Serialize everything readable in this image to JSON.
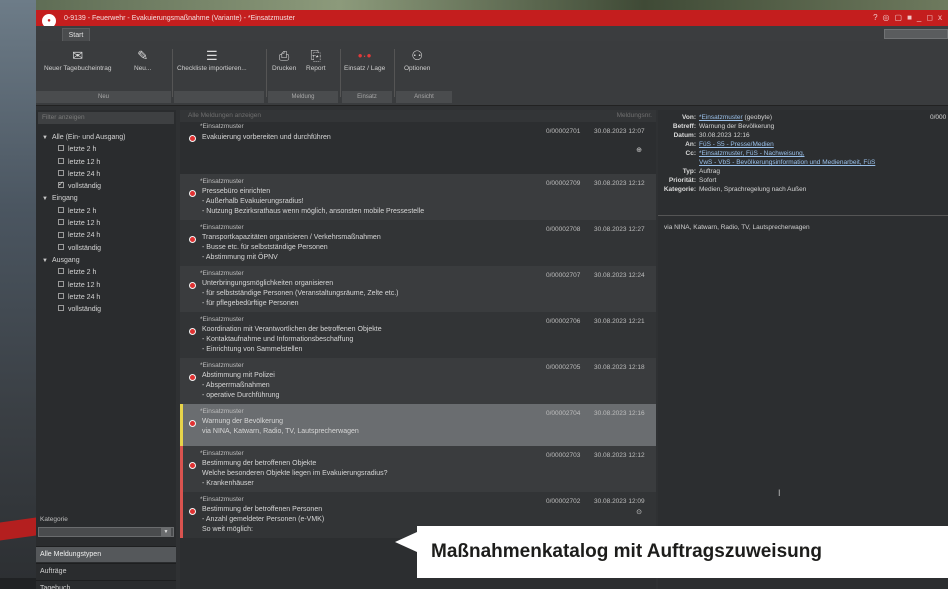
{
  "window": {
    "title": "0-9139 - Feuerwehr - Evakuierungsmaßnahme (Variante) - *Einsatzmuster",
    "controls": [
      "?",
      "◎",
      "▢",
      "■",
      "_",
      "◻",
      "x"
    ]
  },
  "tabs": [
    {
      "label": "Start"
    }
  ],
  "ribbon": {
    "buttons": [
      {
        "label": "Neuer Tagebucheintrag",
        "icon": "✉"
      },
      {
        "label": "Neu...",
        "icon": "✎"
      },
      {
        "label": "Checkliste importieren...",
        "icon": "☰"
      },
      {
        "label": "Drucken",
        "icon": "⎙"
      },
      {
        "label": "Report",
        "icon": "⎘"
      },
      {
        "label": "Einsatz / Lage",
        "icon": "•·•"
      },
      {
        "label": "Optionen",
        "icon": "⚇"
      }
    ],
    "groups": [
      {
        "label": "Neu"
      },
      {
        "label": "Meldung"
      },
      {
        "label": "Einsatz"
      },
      {
        "label": "Ansicht"
      }
    ]
  },
  "left_panel": {
    "filter_placeholder": "Filter anzeigen",
    "tree": [
      {
        "type": "group",
        "label": "Alle (Ein- und Ausgang)"
      },
      {
        "type": "child",
        "label": "letzte 2 h",
        "checked": false
      },
      {
        "type": "child",
        "label": "letzte 12 h",
        "checked": false
      },
      {
        "type": "child",
        "label": "letzte 24 h",
        "checked": false
      },
      {
        "type": "child",
        "label": "vollständig",
        "checked": true
      },
      {
        "type": "group",
        "label": "Eingang"
      },
      {
        "type": "child",
        "label": "letzte 2 h",
        "checked": false
      },
      {
        "type": "child",
        "label": "letzte 12 h",
        "checked": false
      },
      {
        "type": "child",
        "label": "letzte 24 h",
        "checked": false
      },
      {
        "type": "child",
        "label": "vollständig",
        "checked": false
      },
      {
        "type": "group",
        "label": "Ausgang"
      },
      {
        "type": "child",
        "label": "letzte 2 h",
        "checked": false
      },
      {
        "type": "child",
        "label": "letzte 12 h",
        "checked": false
      },
      {
        "type": "child",
        "label": "letzte 24 h",
        "checked": false
      },
      {
        "type": "child",
        "label": "vollständig",
        "checked": false
      }
    ],
    "category_label": "Kategorie",
    "category_value": "",
    "nav": [
      {
        "label": "Alle Meldungstypen",
        "active": true
      },
      {
        "label": "Aufträge",
        "active": false
      },
      {
        "label": "Tagebuch",
        "active": false
      }
    ]
  },
  "messages": {
    "header_text": "Alle Meldungen anzeigen",
    "header_right": "Meldungsnr.",
    "items": [
      {
        "author": "*Einsatzmuster",
        "num": "0/00002701",
        "date": "30.08.2023 12:07",
        "lines": [
          "Evakuierung vorbereiten und durchführen"
        ],
        "bar": "",
        "icon": "⊕",
        "bg": "#2c2e30"
      },
      {
        "author": "*Einsatzmuster",
        "num": "0/00002709",
        "date": "30.08.2023 12:12",
        "lines": [
          "Pressebüro einrichten",
          "- Außerhalb Evakuierungsradius!",
          "- Nutzung Bezirksrathaus wenn möglich, ansonsten mobile Pressestelle"
        ],
        "bar": "",
        "icon": "",
        "bg": "#3a3c3e"
      },
      {
        "author": "*Einsatzmuster",
        "num": "0/00002708",
        "date": "30.08.2023 12:27",
        "lines": [
          "Transportkapazitäten organisieren / Verkehrsmaßnahmen",
          "- Busse etc. für selbstständige Personen",
          "- Abstimmung mit ÖPNV"
        ],
        "bar": "",
        "icon": "",
        "bg": "#323436"
      },
      {
        "author": "*Einsatzmuster",
        "num": "0/00002707",
        "date": "30.08.2023 12:24",
        "lines": [
          "Unterbringungsmöglichkeiten organisieren",
          "- für selbstständige Personen (Veranstaltungsräume, Zelte etc.)",
          "- für pflegebedürftige Personen"
        ],
        "bar": "",
        "icon": "",
        "bg": "#3a3c3e"
      },
      {
        "author": "*Einsatzmuster",
        "num": "0/00002706",
        "date": "30.08.2023 12:21",
        "lines": [
          "Koordination mit Verantwortlichen der betroffenen Objekte",
          "- Kontaktaufnahme und Informationsbeschaffung",
          "- Einrichtung von Sammelstellen"
        ],
        "bar": "",
        "icon": "",
        "bg": "#323436"
      },
      {
        "author": "*Einsatzmuster",
        "num": "0/00002705",
        "date": "30.08.2023 12:18",
        "lines": [
          "Abstimmung mit Polizei",
          "- Absperrmaßnahmen",
          "- operative Durchführung"
        ],
        "bar": "",
        "icon": "",
        "bg": "#3a3c3e"
      },
      {
        "author": "*Einsatzmuster",
        "num": "0/00002704",
        "date": "30.08.2023 12:16",
        "lines": [
          "Warnung der Bevölkerung",
          "via NINA, Katwarn, Radio, TV, Lautsprecherwagen"
        ],
        "bar": "#e8d44a",
        "icon": "",
        "bg": "#6a6d70"
      },
      {
        "author": "*Einsatzmuster",
        "num": "0/00002703",
        "date": "30.08.2023 12:12",
        "lines": [
          "Bestimmung der betroffenen Objekte",
          "Welche besonderen Objekte liegen im Evakuierungsradius?",
          "- Krankenhäuser"
        ],
        "bar": "#d9534f",
        "icon": "",
        "bg": "#3a3c3e"
      },
      {
        "author": "*Einsatzmuster",
        "num": "0/00002702",
        "date": "30.08.2023 12:09",
        "lines": [
          "Bestimmung der betroffenen Personen",
          "- Anzahl gemeldeter Personen (e-VMK)",
          "So weit möglich:"
        ],
        "bar": "#d9534f",
        "icon": "⊙",
        "bg": "#323436"
      }
    ]
  },
  "detail": {
    "von_label": "Von:",
    "von_value": "*Einsatzmuster",
    "von_suffix": " (geobyte)",
    "von_right": "0/000",
    "betreff_label": "Betreff:",
    "betreff_value": "Warnung der Bevölkerung",
    "datum_label": "Datum:",
    "datum_value": "30.08.2023 12:16",
    "an_label": "An:",
    "an_value": "FüS - S5 - Presse/Medien",
    "cc_label": "Cc:",
    "cc_value1": "*Einsatzmuster, FüS - Nachweisung,",
    "cc_value2": "VwS - VbS - Bevölkerungsinformation und Medienarbeit, FüS",
    "typ_label": "Typ:",
    "typ_value": "Auftrag",
    "prio_label": "Priorität:",
    "prio_value": "Sofort",
    "kat_label": "Kategorie:",
    "kat_value": "Medien, Sprachregelung nach Außen",
    "body": "via NINA, Katwarn, Radio, TV, Lautsprecherwagen"
  },
  "callout": {
    "text": "Maßnahmenkatalog mit Auftragszuweisung"
  }
}
